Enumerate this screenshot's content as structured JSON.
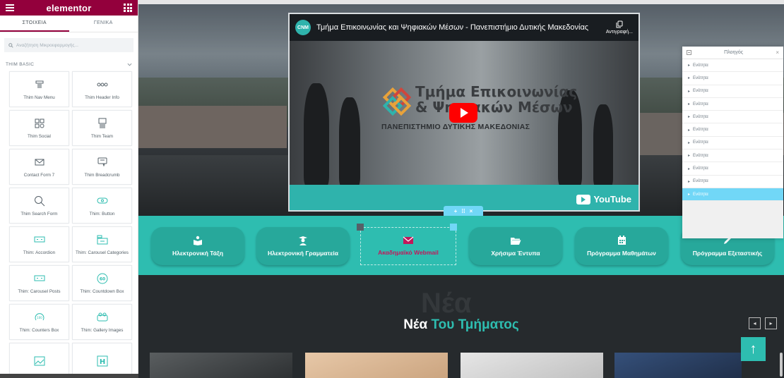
{
  "editor": {
    "brand": "elementor",
    "tabs": [
      "ΣΤΟΙΧΕΙΑ",
      "ΓΕΝΙΚΑ"
    ],
    "search_placeholder": "Αναζήτηση Μικροεφαρμογής...",
    "category": "THIM BASIC",
    "widgets": [
      "Thim Nav Menu",
      "Thim Header Info",
      "Thim Social",
      "Thim Team",
      "Contact Form 7",
      "Thim Breadcrumb",
      "Thim Search Form",
      "Thim: Button",
      "Thim: Accordion",
      "Thim: Carousel Categories",
      "Thim: Carousel Posts",
      "Thim: Countdown Box",
      "Thim: Counters Box",
      "Thim: Gallery Images"
    ]
  },
  "video": {
    "channel_badge": "CNM",
    "title": "Τμήμα Επικοινωνίας και Ψηφιακών Μέσων - Πανεπιστήμιο Δυτικής Μακεδονίας",
    "copy_label": "Αντιγραφή...",
    "logo_line1": "Τμήμα Επικοινωνίας",
    "logo_line2": "& Ψηφιακών Μέσων",
    "logo_line3": "ΠΑΝΕΠΙΣΤΗΜΙΟ ΔΥΤΙΚΗΣ ΜΑΚΕΔΟΝΙΑΣ",
    "youtube": "YouTube"
  },
  "quicklinks": [
    "Ηλεκτρονική Τάξη",
    "Ηλεκτρονική Γραμματεία",
    "Ακαδημαϊκό Webmail",
    "Χρήσιμα Έντυπα",
    "Πρόγραμμα Μαθημάτων",
    "Πρόγραμμα Εξεταστικής"
  ],
  "news": {
    "ghost": "Νέα",
    "title_a": "Νέα",
    "title_b": "Του Τμήματος"
  },
  "navigator": {
    "title": "Πλοηγός",
    "rows": [
      "Ενότητα",
      "Ενότητα",
      "Ενότητα",
      "Ενότητα",
      "Ενότητα",
      "Ενότητα",
      "Ενότητα",
      "Ενότητα",
      "Ενότητα",
      "Ενότητα",
      "Ενότητα"
    ]
  },
  "colors": {
    "brand": "#93003c",
    "teal": "#2ebdb0",
    "selection": "#71d7f7"
  }
}
